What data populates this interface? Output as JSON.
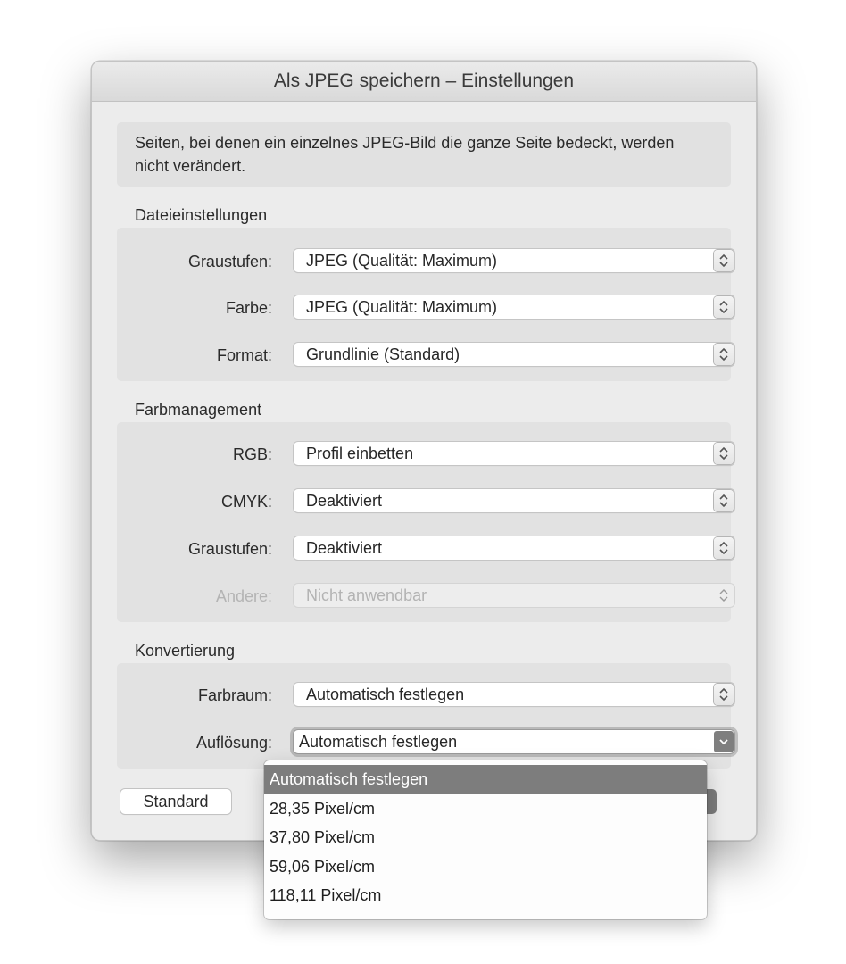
{
  "window": {
    "title": "Als JPEG speichern – Einstellungen"
  },
  "info_text": "Seiten, bei denen ein einzelnes JPEG-Bild die ganze Seite bedeckt, werden nicht verändert.",
  "sections": {
    "file": {
      "title": "Dateieinstellungen",
      "rows": [
        {
          "label": "Graustufen:",
          "value": "JPEG (Qualität: Maximum)"
        },
        {
          "label": "Farbe:",
          "value": "JPEG (Qualität: Maximum)"
        },
        {
          "label": "Format:",
          "value": "Grundlinie (Standard)"
        }
      ]
    },
    "color": {
      "title": "Farbmanagement",
      "rows": [
        {
          "label": "RGB:",
          "value": "Profil einbetten"
        },
        {
          "label": "CMYK:",
          "value": "Deaktiviert"
        },
        {
          "label": "Graustufen:",
          "value": "Deaktiviert"
        },
        {
          "label": "Andere:",
          "value": "Nicht anwendbar"
        }
      ]
    },
    "conversion": {
      "title": "Konvertierung",
      "rows": [
        {
          "label": "Farbraum:",
          "value": "Automatisch festlegen"
        },
        {
          "label": "Auflösung:",
          "value": "Automatisch festlegen"
        }
      ]
    }
  },
  "buttons": {
    "standard": "Standard"
  },
  "resolution_menu": {
    "selected_index": 0,
    "options": [
      "Automatisch festlegen",
      "28,35 Pixel/cm",
      "37,80 Pixel/cm",
      "59,06 Pixel/cm",
      "118,11 Pixel/cm"
    ]
  }
}
